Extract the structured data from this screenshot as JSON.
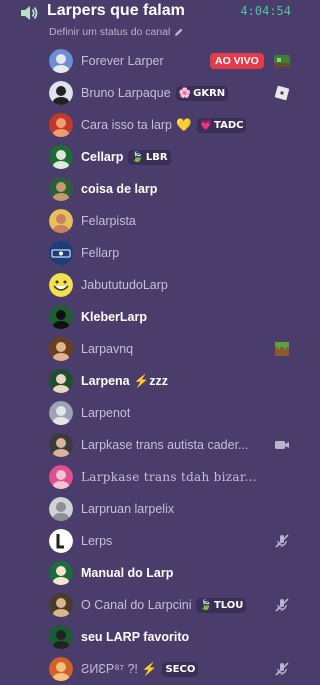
{
  "channel": {
    "name": "Larpers que falam",
    "timer": "4:04:54",
    "status_placeholder": "Definir um status do canal"
  },
  "colors": {
    "live": "#e23b4a",
    "timer": "#4fc3a1",
    "bg": "#4a3d6b"
  },
  "members": [
    {
      "name": "Forever Larper",
      "bold": false,
      "live": "AO VIVO",
      "right_icon": "stream-thumbnail-icon",
      "avatar": "pixel-avatar"
    },
    {
      "name": "Bruno Larpaque",
      "bold": false,
      "tag": {
        "icon": "🌸",
        "text": "GKRN"
      },
      "right_icon": "roblox-icon",
      "avatar": "penguin-avatar"
    },
    {
      "name": "Cara isso ta larp",
      "bold": false,
      "emoji": "💛",
      "tag": {
        "icon": "💗",
        "text": "TADC"
      },
      "avatar": "red-avatar"
    },
    {
      "name": "Cellarp",
      "bold": true,
      "tag": {
        "icon": "🍃",
        "text": "LBR"
      },
      "avatar": "green-avatar"
    },
    {
      "name": "coisa de larp",
      "bold": true,
      "avatar": "man-avatar"
    },
    {
      "name": "Felarpista",
      "bold": false,
      "avatar": "blonde-avatar"
    },
    {
      "name": "Fellarp",
      "bold": false,
      "avatar": "ftl-avatar"
    },
    {
      "name": "JabututudoLarp",
      "bold": false,
      "avatar": "troll-face-avatar"
    },
    {
      "name": "KleberLarp",
      "bold": true,
      "avatar": "dark-avatar"
    },
    {
      "name": "Larpavnq",
      "bold": false,
      "right_icon": "minecraft-icon",
      "avatar": "minecraft-avatar"
    },
    {
      "name": "Larpena",
      "bold": true,
      "emoji": "⚡",
      "suffix": "zzz",
      "avatar": "anime-avatar"
    },
    {
      "name": "Larpenot",
      "bold": false,
      "avatar": "gray-avatar"
    },
    {
      "name": "Larpkase trans autista cader...",
      "bold": false,
      "right_icon": "camera-icon",
      "avatar": "girl-avatar"
    },
    {
      "name": "Larpkase trans tdah bizar...",
      "bold": false,
      "fancy": true,
      "avatar": "pink-avatar"
    },
    {
      "name": "Larpruan larpelix",
      "bold": false,
      "avatar": "statue-avatar"
    },
    {
      "name": "Lerps",
      "bold": false,
      "right_icon": "muted-mic-icon",
      "avatar": "l-avatar"
    },
    {
      "name": "Manual do Larp",
      "bold": true,
      "avatar": "manual-avatar"
    },
    {
      "name": "O Canal do Larpcini",
      "bold": false,
      "tag": {
        "icon": "🍃",
        "text": "TLOU"
      },
      "right_icon": "muted-mic-icon",
      "avatar": "dog-avatar"
    },
    {
      "name": "seu LARP favorito",
      "bold": true,
      "avatar": "fav-avatar"
    },
    {
      "name": "ƧИƐP⁸⁷ ?!",
      "bold": false,
      "emoji": "⚡",
      "tag": {
        "icon": "",
        "text": "SECO"
      },
      "right_icon": "muted-mic-icon",
      "avatar": "orange-avatar"
    }
  ]
}
